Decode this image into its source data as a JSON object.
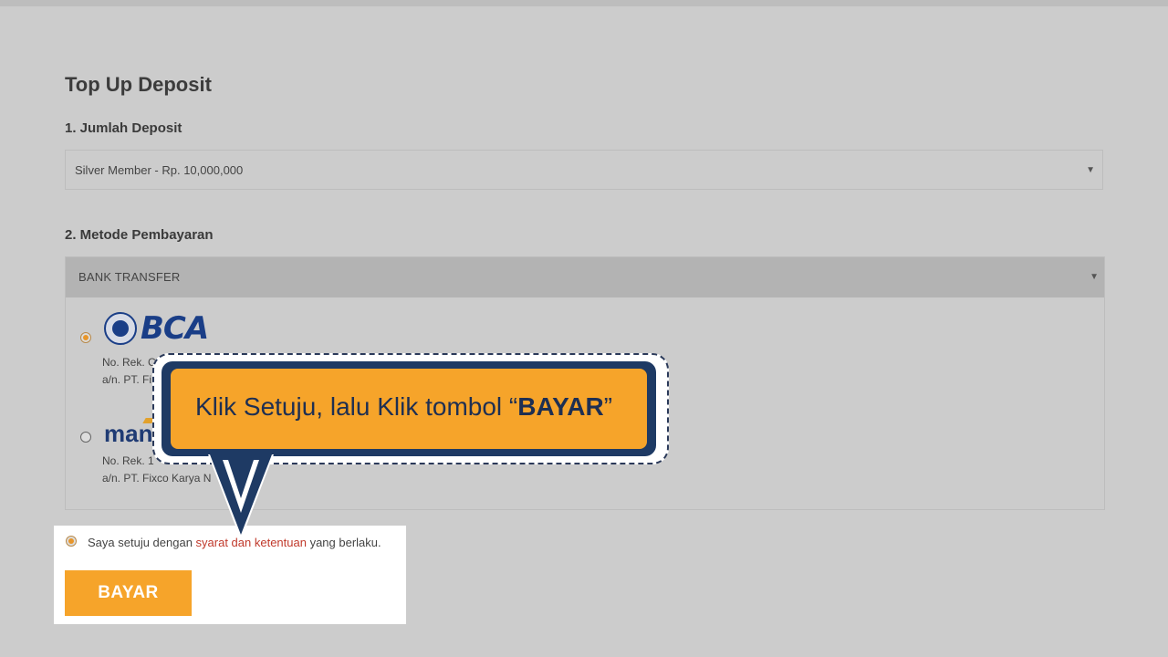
{
  "page": {
    "title": "Top Up Deposit"
  },
  "deposit": {
    "label": "1. Jumlah Deposit",
    "selected": "Silver Member - Rp. 10,000,000"
  },
  "payment": {
    "label": "2. Metode Pembayaran",
    "method": "BANK TRANSFER",
    "banks": [
      {
        "name": "BCA",
        "selected": true,
        "account_line": "No. Rek. C",
        "holder_line": "a/n. PT. Fi"
      },
      {
        "name": "mandiri",
        "logo_visible_text": "man",
        "selected": false,
        "account_line": "No. Rek. 1",
        "holder_line": "a/n. PT. Fixco Karya N"
      }
    ]
  },
  "agreement": {
    "prefix": "Saya setuju dengan ",
    "link": "syarat dan ketentuan",
    "suffix": " yang berlaku.",
    "checked": true
  },
  "pay_button": {
    "label": "BAYAR"
  },
  "callout": {
    "text_prefix": "Klik Setuju, lalu  Klik tombol “",
    "text_bold": "BAYAR",
    "text_suffix": "”"
  },
  "colors": {
    "accent_orange": "#f6a42a",
    "navy": "#1e3a64",
    "link_red": "#c0392b",
    "background": "#cccccc"
  }
}
